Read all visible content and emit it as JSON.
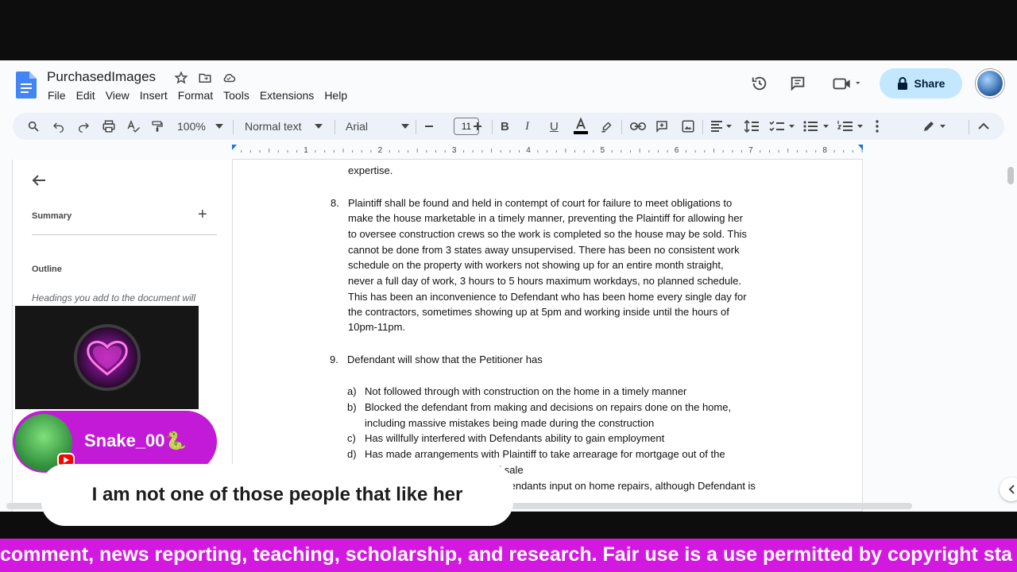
{
  "doc": {
    "title": "PurchasedImages",
    "menu": [
      "File",
      "Edit",
      "View",
      "Insert",
      "Format",
      "Tools",
      "Extensions",
      "Help"
    ]
  },
  "header": {
    "share_label": "Share"
  },
  "toolbar": {
    "zoom": "100%",
    "style": "Normal text",
    "font": "Arial",
    "font_size": "11"
  },
  "ruler": {
    "numbers": [
      "1",
      "2",
      "3",
      "4",
      "5",
      "6",
      "7",
      "8"
    ]
  },
  "sidebar": {
    "summary_label": "Summary",
    "outline_label": "Outline",
    "outline_hint": "Headings you add to the document will"
  },
  "document": {
    "lines": [
      "expertise.",
      "8.",
      "Plaintiff shall be found and held in contempt of court for failure to meet obligations to",
      "make the house marketable in a timely manner, preventing the Plaintiff for allowing her",
      "to oversee construction crews so the work is completed so the house may be sold. This",
      "cannot be done from 3 states away unsupervised. There has been no consistent work",
      "schedule on the property with workers not showing up for an entire month straight,",
      "never a full day of work, 3 hours to 5 hours maximum workdays, no planned schedule.",
      "This has been an inconvenience to Defendant who has been home every single day for",
      "the contractors, sometimes showing up at 5pm and working inside until the hours of",
      "10pm-11pm.",
      "9.",
      "Defendant will show that the Petitioner has",
      "a)",
      "Not followed through with construction on the home in a timely manner",
      "b)",
      "Blocked the defendant from making and decisions on repairs done on the home,",
      "including massive mistakes being made during the construction",
      "c)",
      "Has willfully interfered with Defendants ability to gain employment",
      "d)",
      "Has made arrangements with Plaintiff to take arrearage for mortgage out of the",
      "al sale",
      "fendants input on home repairs, although Defendant is"
    ]
  },
  "stream": {
    "username": "Snake_00🐍",
    "comment": "I am not one of those people that like her",
    "ticker": "comment, news reporting, teaching, scholarship, and research. Fair use is a use permitted by copyright sta"
  }
}
